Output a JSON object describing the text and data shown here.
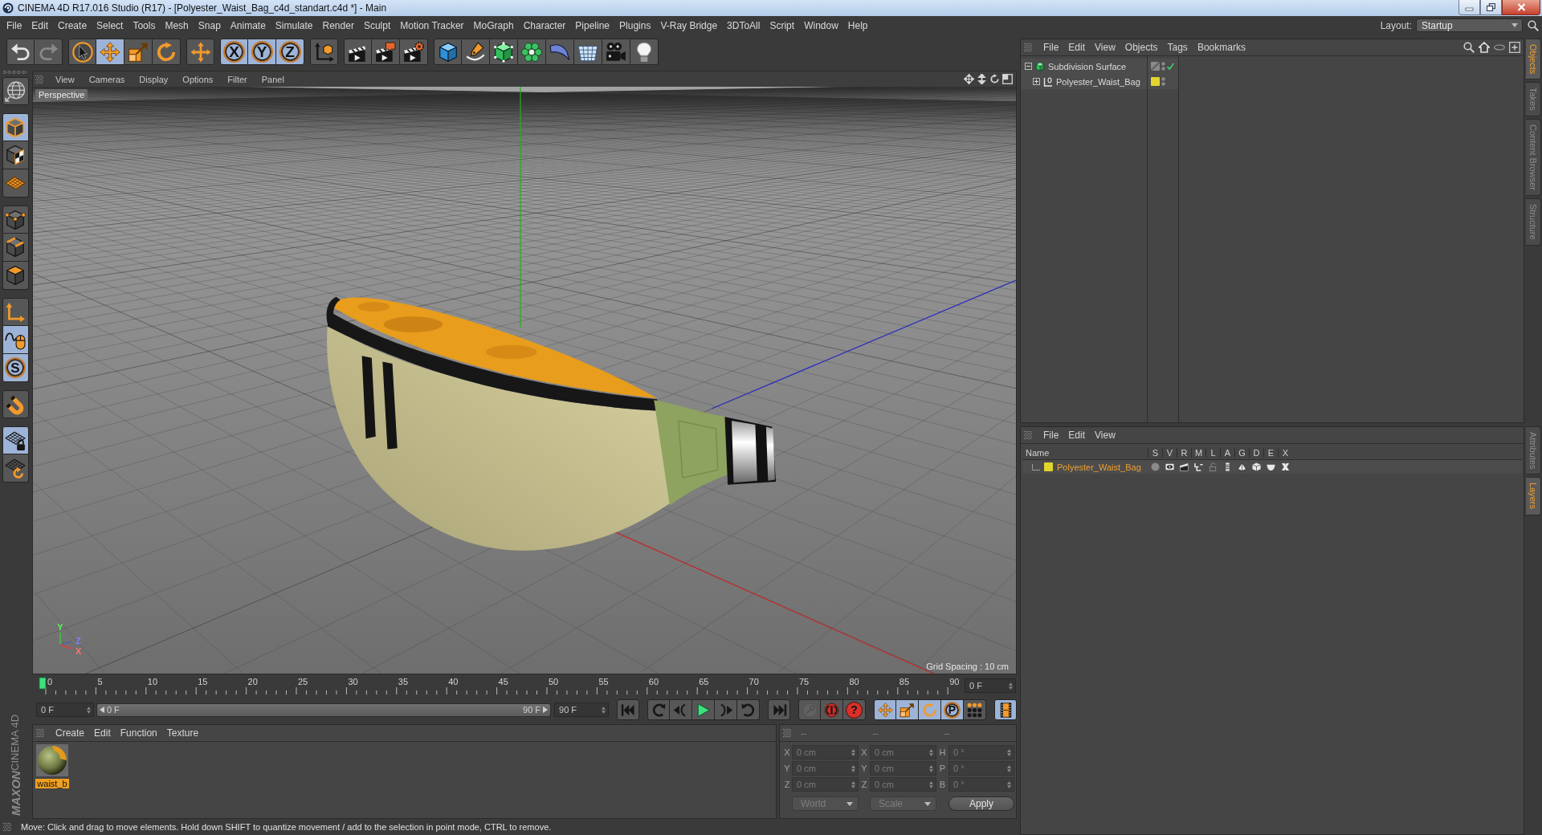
{
  "window": {
    "title": "CINEMA 4D R17.016 Studio (R17) - [Polyester_Waist_Bag_c4d_standart.c4d *] - Main"
  },
  "menu_bar": {
    "items": [
      "File",
      "Edit",
      "Create",
      "Select",
      "Tools",
      "Mesh",
      "Snap",
      "Animate",
      "Simulate",
      "Render",
      "Sculpt",
      "Motion Tracker",
      "MoGraph",
      "Character",
      "Pipeline",
      "Plugins",
      "V-Ray Bridge",
      "3DToAll",
      "Script",
      "Window",
      "Help"
    ],
    "layout_label": "Layout:",
    "layout_value": "Startup"
  },
  "toolbar": {
    "groups": [
      [
        {
          "kind": "undo",
          "selected": false,
          "disabled": false
        },
        {
          "kind": "redo",
          "selected": false,
          "disabled": true
        }
      ],
      [
        {
          "kind": "select",
          "selected": false,
          "disabled": false
        },
        {
          "kind": "move",
          "selected": true,
          "disabled": false
        },
        {
          "kind": "scale",
          "selected": false,
          "disabled": false
        },
        {
          "kind": "rotate",
          "selected": false,
          "disabled": false
        }
      ],
      [
        {
          "kind": "transform",
          "selected": false,
          "disabled": false
        }
      ],
      [
        {
          "kind": "axislock",
          "label": "X",
          "selected": true,
          "disabled": false
        },
        {
          "kind": "axislock",
          "label": "Y",
          "selected": true,
          "disabled": false
        },
        {
          "kind": "axislock",
          "label": "Z",
          "selected": true,
          "disabled": false
        }
      ],
      [
        {
          "kind": "coords",
          "selected": false,
          "disabled": false
        }
      ],
      [
        {
          "kind": "renderview",
          "selected": false,
          "disabled": false
        },
        {
          "kind": "renderpicture",
          "selected": false,
          "disabled": false
        },
        {
          "kind": "rendersettings",
          "selected": false,
          "disabled": false
        }
      ],
      [
        {
          "kind": "cube",
          "selected": false,
          "disabled": false
        },
        {
          "kind": "pen",
          "selected": false,
          "disabled": false
        },
        {
          "kind": "subdivision",
          "selected": false,
          "disabled": false
        },
        {
          "kind": "cloner",
          "selected": false,
          "disabled": false
        },
        {
          "kind": "deformer",
          "selected": false,
          "disabled": false
        },
        {
          "kind": "floor",
          "selected": false,
          "disabled": false
        },
        {
          "kind": "camera",
          "selected": false,
          "disabled": false
        },
        {
          "kind": "light",
          "selected": false,
          "disabled": false
        }
      ]
    ]
  },
  "left_tools": {
    "groups": [
      [
        {
          "kind": "editable",
          "selected": false,
          "disabled": false
        }
      ],
      [
        {
          "kind": "model",
          "selected": true,
          "disabled": false
        },
        {
          "kind": "texture",
          "selected": false,
          "disabled": false
        },
        {
          "kind": "workplane",
          "selected": false,
          "disabled": false
        }
      ],
      [
        {
          "kind": "points",
          "selected": false,
          "disabled": false
        },
        {
          "kind": "edges",
          "selected": false,
          "disabled": false
        },
        {
          "kind": "polygons",
          "selected": false,
          "disabled": false
        }
      ],
      [
        {
          "kind": "axis",
          "selected": false,
          "disabled": false
        },
        {
          "kind": "tweak",
          "selected": true,
          "disabled": false
        },
        {
          "kind": "solo",
          "label": "S",
          "selected": true,
          "disabled": false
        }
      ],
      [
        {
          "kind": "magnet",
          "selected": false,
          "disabled": false
        }
      ],
      [
        {
          "kind": "gridlock",
          "selected": true,
          "disabled": false
        },
        {
          "kind": "gridrotate",
          "selected": false,
          "disabled": false
        }
      ]
    ],
    "brand": "MAXON",
    "product": "CINEMA 4D"
  },
  "viewport": {
    "menu": [
      "View",
      "Cameras",
      "Display",
      "Options",
      "Filter",
      "Panel"
    ],
    "camera": "Perspective",
    "axis_labels": [
      "Y",
      "Z",
      "X"
    ],
    "grid_spacing": "Grid Spacing : 10 cm"
  },
  "timeline": {
    "ruler_labels": [
      "0",
      "5",
      "10",
      "15",
      "20",
      "25",
      "30",
      "35",
      "40",
      "45",
      "50",
      "55",
      "60",
      "65",
      "70",
      "75",
      "80",
      "85",
      "90"
    ],
    "playhead": {
      "level": 0
    },
    "current_frame": "0 F",
    "start_frame": "0 F",
    "range": {
      "start": "0 F",
      "end": "90 F",
      "level": 1
    },
    "end_frame": "90 F",
    "buttons": [
      [
        {
          "kind": "start",
          "selected": false,
          "disabled": false
        }
      ],
      [
        {
          "kind": "prevkey",
          "selected": false,
          "disabled": false
        },
        {
          "kind": "prevframe",
          "selected": false,
          "disabled": false
        },
        {
          "kind": "play",
          "selected": false,
          "disabled": false
        },
        {
          "kind": "nextframe",
          "selected": false,
          "disabled": false
        },
        {
          "kind": "nextkey",
          "selected": false,
          "disabled": false
        }
      ],
      [
        {
          "kind": "end",
          "selected": false,
          "disabled": false
        }
      ],
      [
        {
          "kind": "key",
          "selected": false,
          "disabled": true
        },
        {
          "kind": "record",
          "selected": false,
          "disabled": false
        },
        {
          "kind": "help",
          "label": "?",
          "selected": false,
          "disabled": false
        }
      ],
      [
        {
          "kind": "keypos",
          "selected": true,
          "disabled": false
        },
        {
          "kind": "keyscale",
          "selected": true,
          "disabled": false
        },
        {
          "kind": "keyrot",
          "selected": true,
          "disabled": false
        },
        {
          "kind": "param",
          "label": "P",
          "selected": true,
          "disabled": false
        },
        {
          "kind": "dots",
          "selected": false,
          "disabled": false
        }
      ],
      [
        {
          "kind": "film",
          "selected": true,
          "disabled": false
        }
      ]
    ]
  },
  "materials": {
    "menu": [
      "Create",
      "Edit",
      "Function",
      "Texture"
    ],
    "items": [
      {
        "name": "waist_b",
        "selected": true
      }
    ]
  },
  "coordinates": {
    "headers": [
      "--",
      "--",
      "--"
    ],
    "rows": [
      [
        {
          "axis": "X",
          "value": "0 cm"
        },
        {
          "axis": "X",
          "value": "0 cm"
        },
        {
          "axis": "H",
          "value": "0 °"
        }
      ],
      [
        {
          "axis": "Y",
          "value": "0 cm"
        },
        {
          "axis": "Y",
          "value": "0 cm"
        },
        {
          "axis": "P",
          "value": "0 °"
        }
      ],
      [
        {
          "axis": "Z",
          "value": "0 cm"
        },
        {
          "axis": "Z",
          "value": "0 cm"
        },
        {
          "axis": "B",
          "value": "0 °"
        }
      ]
    ],
    "dropdowns": [
      "World",
      "Scale"
    ],
    "apply": "Apply"
  },
  "status_bar": {
    "text": "Move: Click and drag to move elements. Hold down SHIFT to quantize movement / add to the selection in point mode, CTRL to remove."
  },
  "objects": {
    "menu": [
      "File",
      "Edit",
      "View",
      "Objects",
      "Tags",
      "Bookmarks"
    ],
    "tree": [
      {
        "name": "Subdivision Surface",
        "kind": "subdivision",
        "expanded": true,
        "enabled": true,
        "children": [
          {
            "name": "Polyester_Waist_Bag",
            "kind": "null",
            "expanded": false,
            "color": "#e2d42c"
          }
        ]
      }
    ]
  },
  "layers": {
    "menu": [
      "File",
      "Edit",
      "View"
    ],
    "columns": [
      "Name",
      "S",
      "V",
      "R",
      "M",
      "L",
      "A",
      "G",
      "D",
      "E",
      "X"
    ],
    "rows": [
      {
        "name": "Polyester_Waist_Bag",
        "color": "#e2d42c",
        "selected": true,
        "flags": [
          {
            "kind": "solo",
            "on": false
          },
          {
            "kind": "view",
            "on": true
          },
          {
            "kind": "render",
            "on": true
          },
          {
            "kind": "manager",
            "on": true
          },
          {
            "kind": "lock",
            "on": false
          },
          {
            "kind": "animation",
            "on": true
          },
          {
            "kind": "generators",
            "on": true
          },
          {
            "kind": "deformers",
            "on": true
          },
          {
            "kind": "expressions",
            "on": true
          },
          {
            "kind": "xref",
            "on": true
          }
        ]
      }
    ]
  },
  "side_tabs": {
    "top": [
      {
        "label": "Objects",
        "selected": true
      },
      {
        "label": "Takes",
        "selected": false
      },
      {
        "label": "Content Browser",
        "selected": false
      },
      {
        "label": "Structure",
        "selected": false
      }
    ],
    "bottom": [
      {
        "label": "Attributes",
        "selected": false
      },
      {
        "label": "Layers",
        "selected": true
      }
    ]
  }
}
